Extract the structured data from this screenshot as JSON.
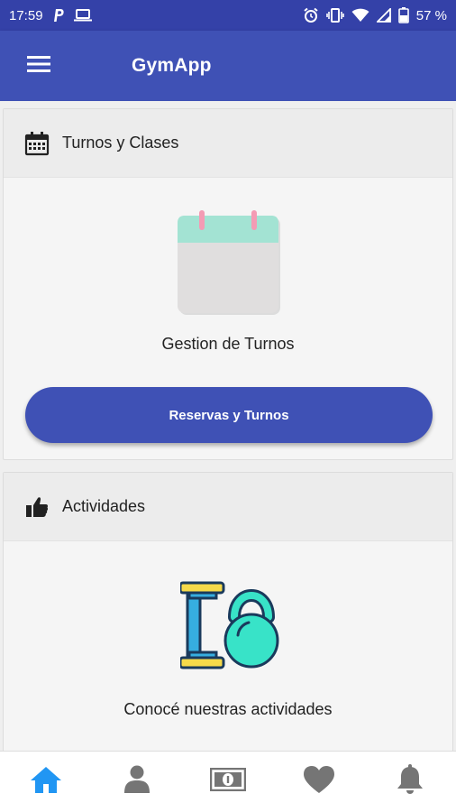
{
  "status_bar": {
    "time": "17:59",
    "battery_percent": "57 %",
    "icons": [
      "parking-p-icon",
      "laptop-icon",
      "alarm-icon",
      "vibrate-icon",
      "wifi-icon",
      "signal-icon",
      "battery-icon"
    ]
  },
  "app_bar": {
    "title": "GymApp",
    "menu_icon": "hamburger-menu-icon"
  },
  "cards": [
    {
      "header_icon": "calendar-icon",
      "title": "Turnos y Clases",
      "illustration": "calendar-illustration",
      "caption": "Gestion de Turnos",
      "button_label": "Reservas y Turnos"
    },
    {
      "header_icon": "thumbs-up-icon",
      "title": "Actividades",
      "illustration": "dumbbell-kettlebell-illustration",
      "caption": "Conocé nuestras actividades"
    }
  ],
  "bottom_nav": {
    "items": [
      "home-icon",
      "user-icon",
      "money-icon",
      "heart-icon",
      "bell-icon"
    ],
    "active": "home-icon"
  },
  "colors": {
    "status_bar": "#3441a8",
    "primary": "#3f51b5",
    "active_nav": "#2196f3",
    "inactive_nav": "#757575",
    "calendar_top": "#a3e3d3",
    "calendar_body": "#e0dede",
    "calendar_pin": "#f49bb4",
    "dumbbell_bar": "#36aee0",
    "dumbbell_plate": "#f6da4a",
    "kettlebell": "#38e3c8",
    "outline": "#1a3a5c"
  }
}
